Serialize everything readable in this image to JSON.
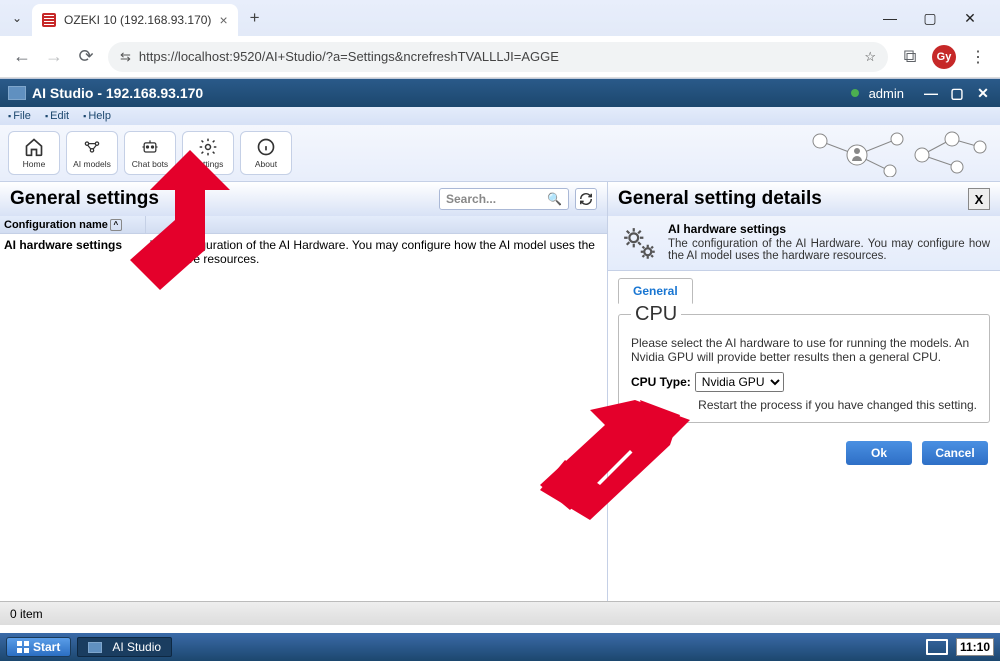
{
  "browser": {
    "tab_title": "OZEKI 10 (192.168.93.170)",
    "url": "https://localhost:9520/AI+Studio/?a=Settings&ncrefreshTVALLLJI=AGGE",
    "avatar": "Gy"
  },
  "app": {
    "title": "AI Studio - 192.168.93.170",
    "user": "admin",
    "menus": [
      "File",
      "Edit",
      "Help"
    ],
    "toolbar": [
      {
        "label": "Home"
      },
      {
        "label": "AI models"
      },
      {
        "label": "Chat bots"
      },
      {
        "label": "Settings"
      },
      {
        "label": "About"
      }
    ]
  },
  "left": {
    "heading": "General settings",
    "search_placeholder": "Search...",
    "col_header": "Configuration name",
    "row_name": "AI hardware settings",
    "row_desc": "The configuration of the AI Hardware. You may configure how the AI model uses the hardware resources.",
    "status": "0 item"
  },
  "right": {
    "heading": "General setting details",
    "title": "AI hardware settings",
    "desc": "The configuration of the AI Hardware. You may configure how the AI model uses the hardware resources.",
    "tab": "General",
    "fieldset_legend": "CPU",
    "fieldset_help": "Please select the AI hardware to use for running the models. An Nvidia GPU will provide better results then a general CPU.",
    "cpu_label": "CPU Type:",
    "cpu_value": "Nvidia GPU",
    "restart_hint": "Restart the process if you have changed this setting.",
    "ok": "Ok",
    "cancel": "Cancel"
  },
  "taskbar": {
    "start": "Start",
    "item": "AI Studio",
    "time": "11:10"
  }
}
